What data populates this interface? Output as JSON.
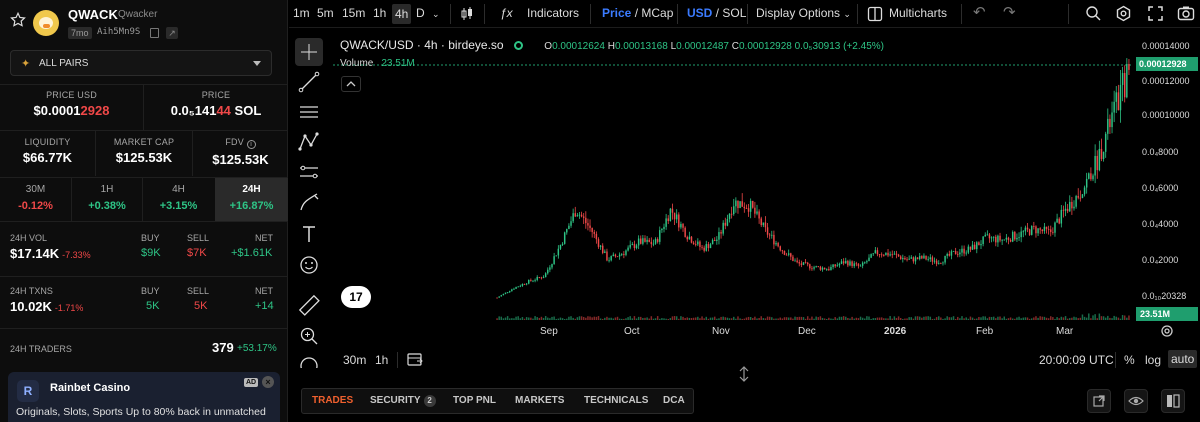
{
  "token": {
    "symbol": "QWACK",
    "name": "Qwacker",
    "age": "7mo",
    "address": "Aih5Mn9S"
  },
  "pairs": {
    "label": "ALL PAIRS"
  },
  "prices": {
    "usd_label": "PRICE USD",
    "usd_prefix": "$0.0001",
    "usd_suffix": "2928",
    "sol_label": "PRICE",
    "sol_prefix": "0.0₅141",
    "sol_suffix": "44",
    "sol_unit": "SOL"
  },
  "metrics": [
    {
      "label": "LIQUIDITY",
      "value": "$66.77K"
    },
    {
      "label": "MARKET CAP",
      "value": "$125.53K"
    },
    {
      "label": "FDV",
      "value": "$125.53K"
    }
  ],
  "timeframes": [
    {
      "label": "30M",
      "change": "-0.12%",
      "dir": "down"
    },
    {
      "label": "1H",
      "change": "+0.38%",
      "dir": "up"
    },
    {
      "label": "4H",
      "change": "+3.15%",
      "dir": "up"
    },
    {
      "label": "24H",
      "change": "+16.87%",
      "dir": "up",
      "active": true
    }
  ],
  "vol": {
    "label": "24H VOL",
    "value": "$17.14K",
    "delta": "-7.33%",
    "buy_label": "BUY",
    "buy": "$9K",
    "sell_label": "SELL",
    "sell": "$7K",
    "net_label": "NET",
    "net": "+$1.61K"
  },
  "txns": {
    "label": "24H TXNS",
    "value": "10.02K",
    "delta": "-1.71%",
    "buy_label": "BUY",
    "buy": "5K",
    "sell_label": "SELL",
    "sell": "5K",
    "net_label": "NET",
    "net": "+14"
  },
  "traders": {
    "label": "24H TRADERS",
    "value": "379",
    "delta": "+53.17%"
  },
  "ad": {
    "tag": "AD",
    "title": "Rainbet Casino",
    "desc": "Originals, Slots, Sports Up to 80% back in unmatched"
  },
  "toolbar": {
    "intervals": [
      "1m",
      "5m",
      "15m",
      "1h",
      "4h",
      "D"
    ],
    "selected_interval": "4h",
    "indicators": "Indicators",
    "price": "Price",
    "mcap": "MCap",
    "usd": "USD",
    "sol": "SOL",
    "display": "Display Options",
    "multicharts": "Multicharts"
  },
  "legend": {
    "title": "QWACK/USD · 4h · birdeye.so",
    "o_label": "O",
    "o": "0.00012624",
    "h_label": "H",
    "h": "0.00013168",
    "l_label": "L",
    "l": "0.00012487",
    "c_label": "C",
    "c": "0.00012928",
    "change": "0.0₅30913 (+2.45%)",
    "volume_label": "Volume",
    "volume": "23.51M"
  },
  "axis": {
    "y_ticks": [
      "0.00014000",
      "0.00012000",
      "0.00010000",
      "0.0₄8000",
      "0.0₄6000",
      "0.0₄4000",
      "0.0₄2000",
      "0.0₁₀20328"
    ],
    "x_ticks": [
      "Sep",
      "Oct",
      "Nov",
      "Dec",
      "2026",
      "Feb",
      "Mar"
    ],
    "price_label": "0.00012928",
    "volume_label": "23.51M"
  },
  "chart_data": {
    "type": "candlestick",
    "interval": "4h",
    "pair": "QWACK/USD",
    "ylim": [
      1.7e-06,
      0.000143
    ],
    "x_ticks": [
      "Sep",
      "Oct",
      "Nov",
      "Dec",
      "2026",
      "Feb",
      "Mar"
    ],
    "y_ticks": [
      0.00014,
      0.00012,
      0.0001,
      8e-05,
      6e-05,
      4e-05,
      2e-05
    ],
    "last_close": 0.00012928,
    "last_volume": "23.51M",
    "series_close": [
      [
        "Aug 20",
        3e-06
      ],
      [
        "Aug 24",
        8e-06
      ],
      [
        "Aug 28",
        1.2e-05
      ],
      [
        "Sep 1",
        1.5e-05
      ],
      [
        "Sep 4",
        3.2e-05
      ],
      [
        "Sep 6",
        5.2e-05
      ],
      [
        "Sep 9",
        4e-05
      ],
      [
        "Sep 12",
        2.4e-05
      ],
      [
        "Sep 16",
        2.8e-05
      ],
      [
        "Sep 19",
        3.4e-05
      ],
      [
        "Sep 22",
        3.3e-05
      ],
      [
        "Sep 25",
        5.2e-05
      ],
      [
        "Sep 28",
        3.8e-05
      ],
      [
        "Oct 1",
        3e-05
      ],
      [
        "Oct 4",
        3.6e-05
      ],
      [
        "Oct 7",
        5.6e-05
      ],
      [
        "Oct 10",
        5.4e-05
      ],
      [
        "Oct 13",
        4e-05
      ],
      [
        "Oct 16",
        3e-05
      ],
      [
        "Oct 20",
        2.2e-05
      ],
      [
        "Oct 25",
        2e-05
      ],
      [
        "Nov 1",
        1.9e-05
      ],
      [
        "Nov 10",
        2.3e-05
      ],
      [
        "Nov 20",
        2e-05
      ],
      [
        "Nov 28",
        2.8e-05
      ],
      [
        "Dec 5",
        2.7e-05
      ],
      [
        "Dec 15",
        2.4e-05
      ],
      [
        "Dec 25",
        2.5e-05
      ],
      [
        "Jan 1",
        2.3e-05
      ],
      [
        "Jan 10",
        2.8e-05
      ],
      [
        "Jan 18",
        3e-05
      ],
      [
        "Jan 26",
        3.6e-05
      ],
      [
        "Feb 3",
        3.5e-05
      ],
      [
        "Feb 10",
        3.8e-05
      ],
      [
        "Feb 18",
        4.1e-05
      ],
      [
        "Feb 25",
        3.9e-05
      ],
      [
        "Mar 2",
        5.2e-05
      ],
      [
        "Mar 8",
        6.2e-05
      ],
      [
        "Mar 12",
        7.9e-05
      ],
      [
        "Mar 15",
        0.000105
      ],
      [
        "Mar 18",
        0.000129
      ]
    ]
  },
  "chart_bar": {
    "ranges": [
      "30m",
      "1h"
    ],
    "time": "20:00:09 UTC",
    "percent": "%",
    "log": "log",
    "auto": "auto"
  },
  "tabs": [
    {
      "label": "TRADES",
      "active": true
    },
    {
      "label": "SECURITY",
      "badge": "2"
    },
    {
      "label": "TOP PNL"
    },
    {
      "label": "MARKETS"
    },
    {
      "label": "TECHNICALS"
    },
    {
      "label": "DCA"
    }
  ],
  "colors": {
    "up": "#2ec486",
    "down": "#f04848",
    "accent": "#f0602e",
    "blue": "#3b7bff"
  }
}
